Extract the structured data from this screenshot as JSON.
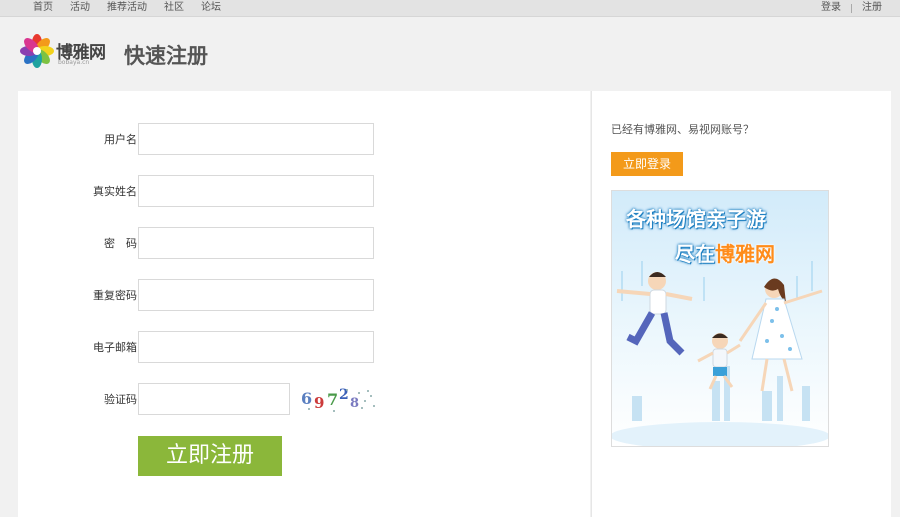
{
  "topbar": {
    "nav": [
      "首页",
      "活动",
      "推荐活动",
      "社区",
      "论坛"
    ],
    "login": "登录",
    "register": "注册"
  },
  "header": {
    "logo_text": "博雅网",
    "logo_sub": "bobaya.cn",
    "title": "快速注册"
  },
  "form": {
    "username_label": "用户名：",
    "realname_label": "真实姓名：",
    "password_label": "密　码：",
    "confirm_label": "重复密码：",
    "email_label": "电子邮箱：",
    "captcha_label": "验证码：",
    "captcha_text": [
      "6",
      "9",
      "7",
      "2",
      "8"
    ],
    "submit_label": "立即注册"
  },
  "sidebar": {
    "hint": "已经有博雅网、易视网账号？",
    "login_button": "立即登录",
    "promo_line1": "各种场馆亲子游",
    "promo_line2_prefix": "尽在",
    "promo_line2_brand": "博雅网"
  },
  "colors": {
    "submit": "#8bb73a",
    "login_button": "#f39a1a",
    "promo_sky": "#dff0fb"
  }
}
